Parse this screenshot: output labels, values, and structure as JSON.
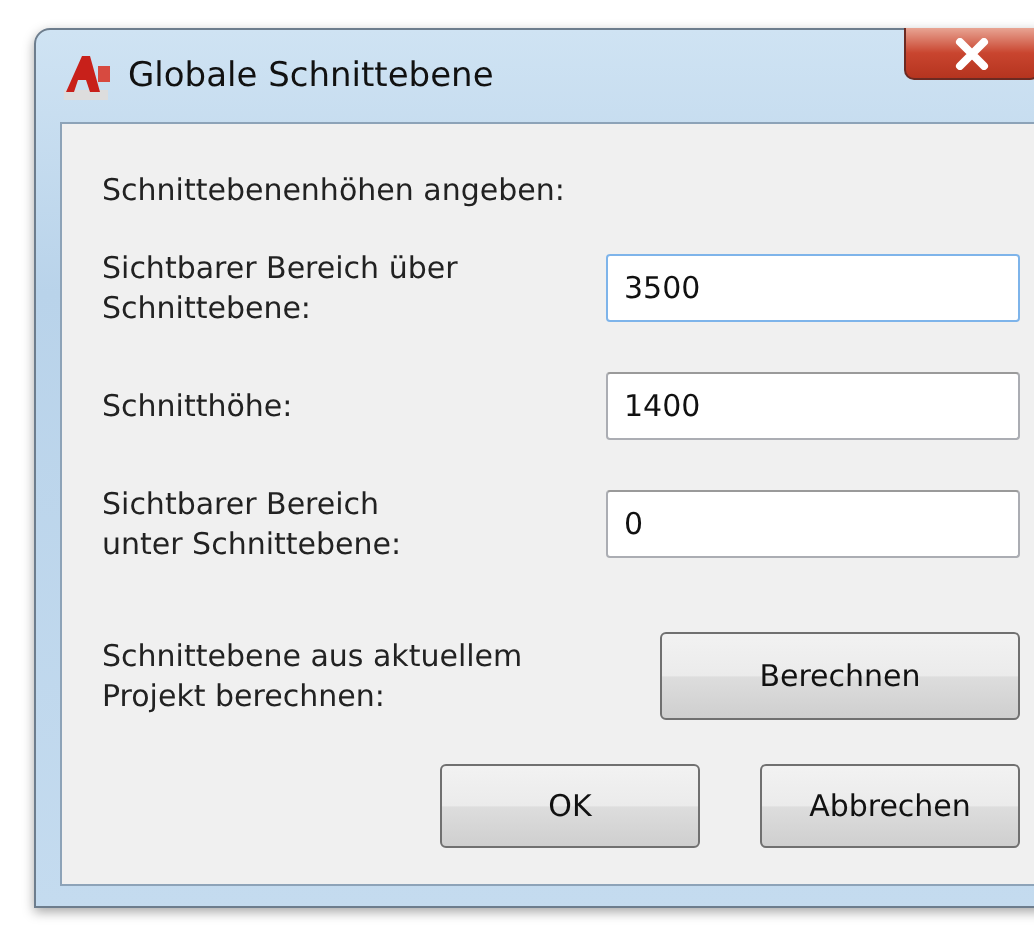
{
  "window": {
    "title": "Globale Schnittebene"
  },
  "heading": "Schnittebenenhöhen angeben:",
  "fields": [
    {
      "label": "Sichtbarer Bereich über\nSchnittebene:",
      "value": "3500",
      "focused": true
    },
    {
      "label": "Schnitthöhe:",
      "value": "1400",
      "focused": false
    },
    {
      "label": "Sichtbarer Bereich\nunter Schnittebene:",
      "value": "0",
      "focused": false
    }
  ],
  "calculate": {
    "label": "Schnittebene aus aktuellem\nProjekt berechnen:",
    "button": "Berechnen"
  },
  "buttons": [
    "OK",
    "Abbrechen"
  ]
}
